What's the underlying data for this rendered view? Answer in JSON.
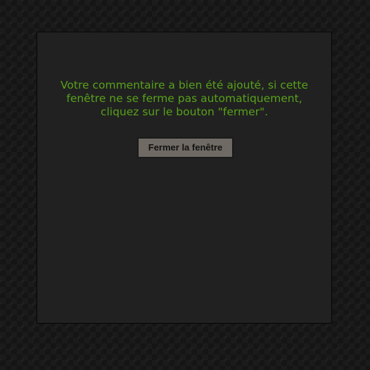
{
  "dialog": {
    "message": "Votre commentaire a bien été ajouté, si cette\nfenêtre ne se ferme pas automatiquement,\ncliquez sur le bouton \"fermer\".",
    "close_button_label": "Fermer la fenêtre"
  },
  "colors": {
    "page_background": "#151515",
    "panel_background": "#212121",
    "message_text": "#58a11b",
    "button_background": "#6f6a64",
    "button_text": "#111111"
  }
}
